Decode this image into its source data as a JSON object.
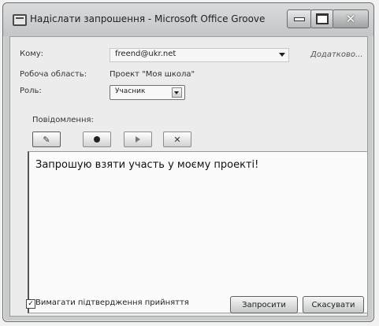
{
  "window": {
    "title": "Надіслати запрошення - Microsoft Office Groove",
    "icons": {
      "app": "groove-app-icon",
      "min": "minimize-icon",
      "max": "maximize-icon",
      "close": "close-icon"
    }
  },
  "form": {
    "to_label": "Кому:",
    "to_value": "freend@ukr.net",
    "more_link": "Додатково...",
    "workspace_label": "Робоча область:",
    "workspace_value": "Проект \"Моя школа\"",
    "role_label": "Роль:",
    "role_value": "Учасник"
  },
  "message": {
    "label": "Повідомлення:",
    "text": "Запрошую взяти участь у моєму проекті!",
    "tools": [
      {
        "name": "edit-text-icon",
        "glyph": "✎"
      },
      {
        "name": "record-icon",
        "glyph": ""
      },
      {
        "name": "play-icon",
        "glyph": ""
      },
      {
        "name": "delete-icon",
        "glyph": "✕"
      }
    ]
  },
  "footer": {
    "require_confirmation_label": "Вимагати підтвердження прийняття",
    "require_confirmation_checked": true,
    "invite_button": "Запросити",
    "cancel_button": "Скасувати"
  }
}
